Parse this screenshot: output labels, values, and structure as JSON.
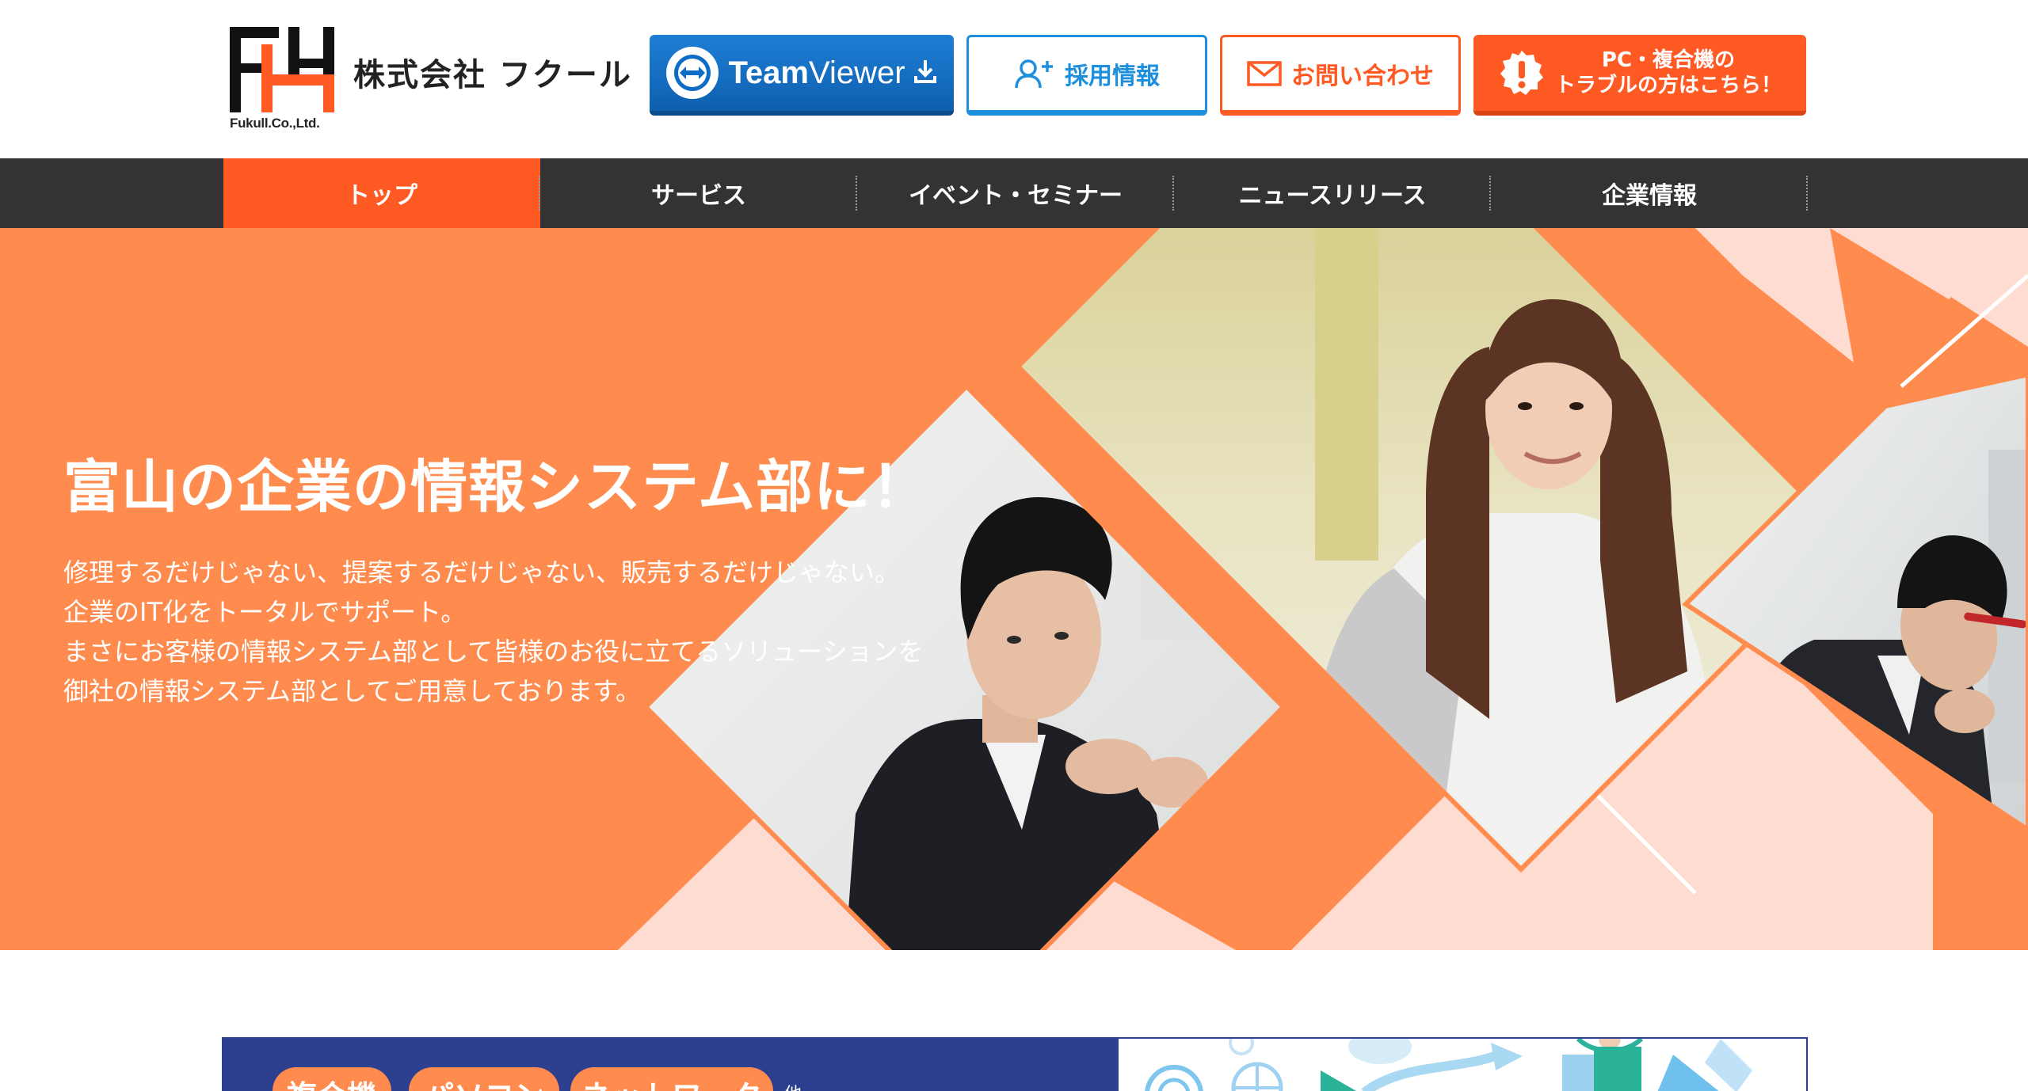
{
  "header": {
    "company_name": "株式会社 フクール",
    "logo_subtext": "Fukull.Co.,Ltd.",
    "teamviewer": {
      "bold": "Team",
      "regular": "Viewer"
    },
    "recruit_label": "採用情報",
    "contact_label": "お問い合わせ",
    "trouble_line1": "PC・複合機の",
    "trouble_line2": "トラブルの方はこちら！"
  },
  "nav": {
    "items": [
      {
        "label": "トップ",
        "active": true
      },
      {
        "label": "サービス"
      },
      {
        "label": "イベント・セミナー"
      },
      {
        "label": "ニュースリリース"
      },
      {
        "label": "企業情報"
      }
    ]
  },
  "hero": {
    "title": "富山の企業の情報システム部に！",
    "lines": [
      "修理するだけじゃない、提案するだけじゃない、販売するだけじゃない。",
      "企業のIT化をトータルでサポート。",
      "まさにお客様の情報システム部として皆様のお役に立てるソリューションを",
      "御社の情報システム部としてご用意しております。"
    ]
  },
  "services": {
    "tags": [
      "複合機",
      "パソコン",
      "ネットワーク"
    ],
    "suffix": "他"
  },
  "colors": {
    "brand_orange": "#ff5a24",
    "hero_orange": "#ff8c4e",
    "hero_pink": "#ffdcd2",
    "nav_dark": "#333333",
    "recruit_blue": "#1e8fdc",
    "teamviewer_blue": "#0e6cc4",
    "services_navy": "#2d3f8f"
  },
  "icons": {
    "logo": "fukull-logo-icon",
    "teamviewer": "teamviewer-arrows-icon",
    "download": "download-icon",
    "recruit": "user-plus-icon",
    "contact": "mail-icon",
    "trouble": "alert-icon"
  }
}
